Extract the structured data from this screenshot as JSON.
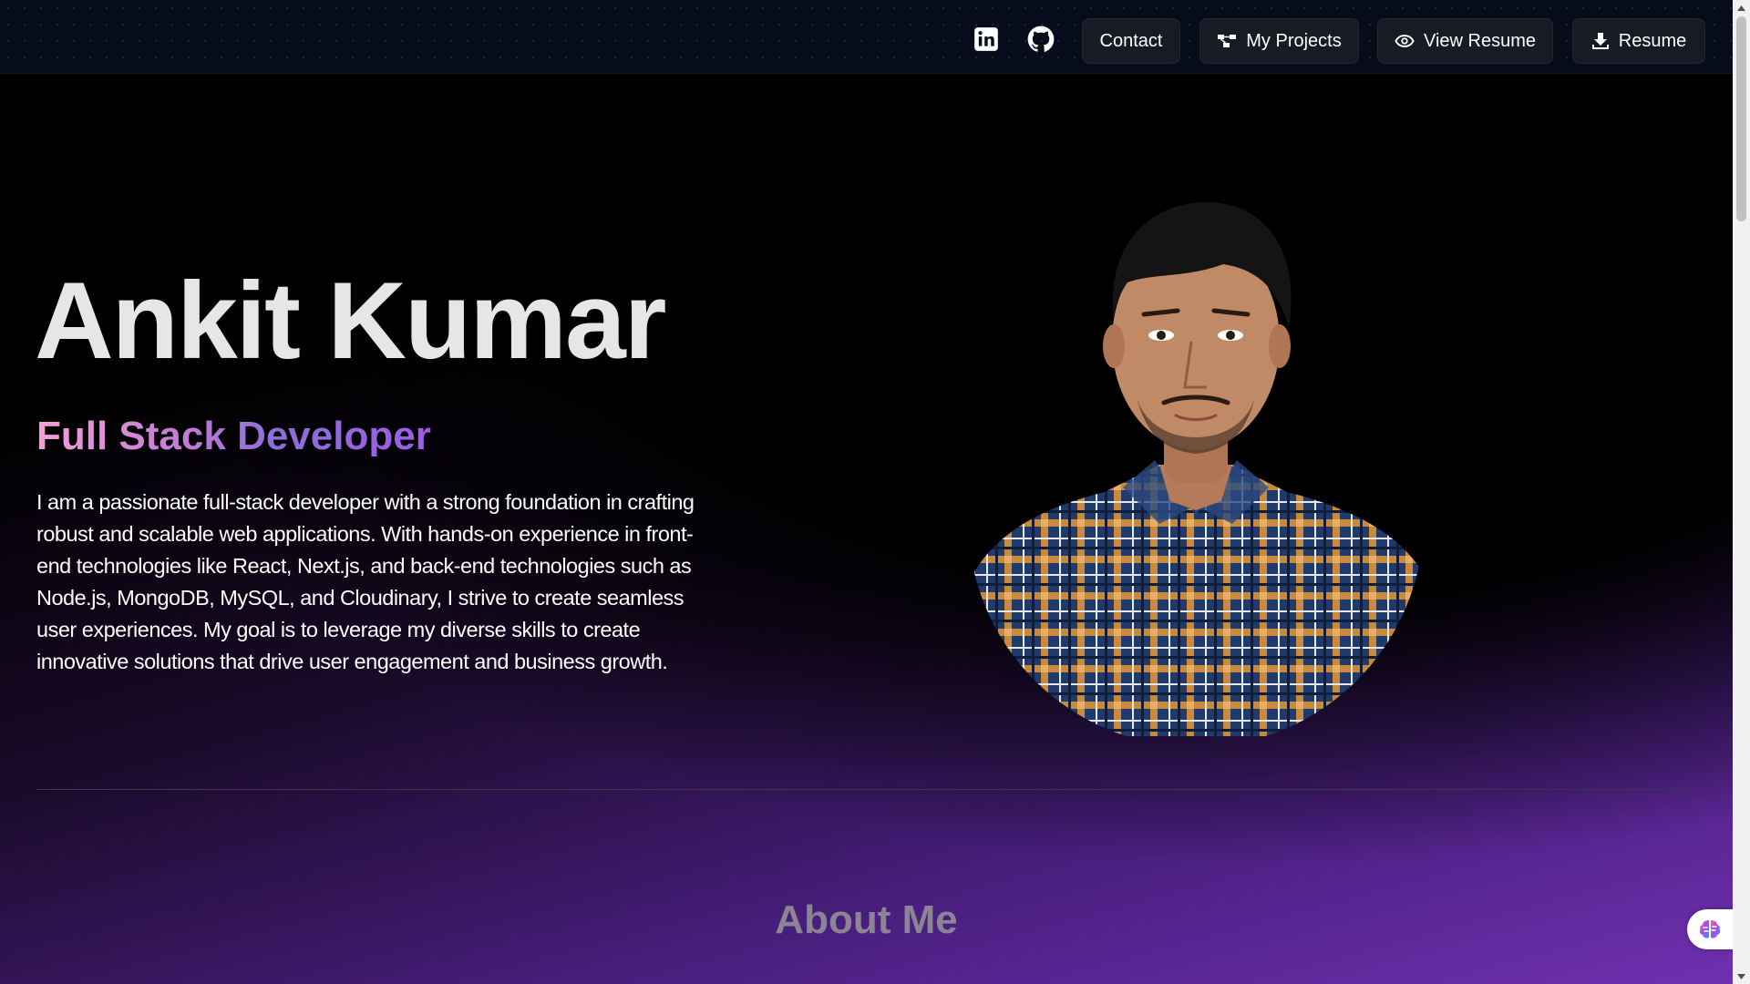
{
  "nav": {
    "icons": [
      "linkedin-icon",
      "github-icon"
    ],
    "contact_label": "Contact",
    "projects_label": "My Projects",
    "view_resume_label": "View Resume",
    "resume_label": "Resume"
  },
  "hero": {
    "name": "Ankit Kumar",
    "role": "Full Stack Developer",
    "bio": "I am a passionate full-stack developer with a strong foundation in crafting robust and scalable web applications. With hands-on experience in front-end technologies like React, Next.js, and back-end technologies such as Node.js, MongoDB, MySQL, and Cloudinary, I strive to create seamless user experiences. My goal is to leverage my diverse skills to create innovative solutions that drive user engagement and business growth."
  },
  "about": {
    "heading": "About Me"
  },
  "colors": {
    "nav_bg": "#060c1a",
    "button_bg": "#181b24",
    "gradient_purple": "#7030b0",
    "role_gradient": [
      "#f5a0d8",
      "#8b6fd8",
      "#9d5ce8"
    ]
  }
}
